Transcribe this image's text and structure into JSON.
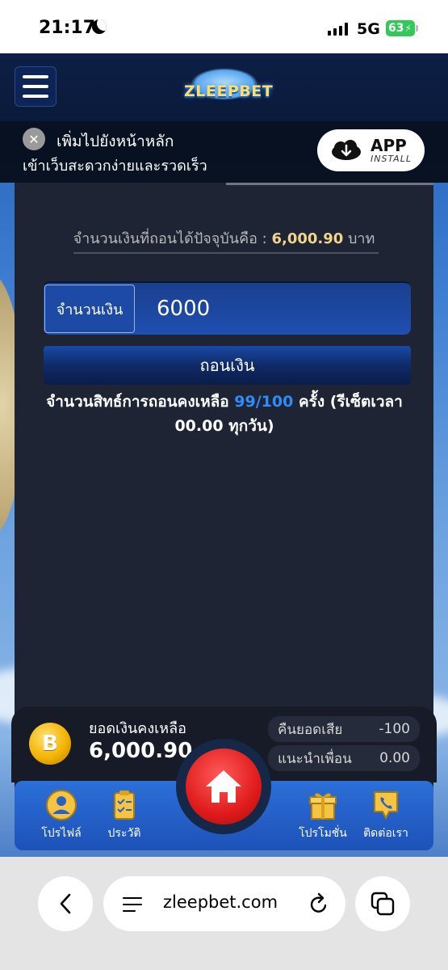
{
  "status": {
    "time": "21:17",
    "network": "5G",
    "battery": "63"
  },
  "header": {
    "logo_text": "ZLEEPBET"
  },
  "banner": {
    "title": "เพิ่มไปยังหน้าหลัก",
    "subtitle": "เข้าเว็บสะดวกง่ายและรวดเร็ว",
    "app_label": "APP",
    "install_label": "INSTALL"
  },
  "withdraw": {
    "available_label": "จำนวนเงินที่ถอนได้ปัจจุบันคือ : ",
    "available_value": "6,000.90",
    "currency": " บาท",
    "amount_label": "จำนวนเงิน",
    "amount_value": "6000",
    "button_label": "ถอนเงิน",
    "rights_prefix": "จำนวนสิทธ์การถอนคงเหลือ ",
    "rights_value": "99/100",
    "rights_suffix": " ครั้ง (รีเซ็ตเวลา 00.00 ทุกวัน)"
  },
  "dashboard": {
    "coin_symbol": "B",
    "balance_label": "ยอดเงินคงเหลือ",
    "balance_value": "6,000.90",
    "cashback_label": "คืนยอดเสีย",
    "cashback_value": "-100",
    "referral_label": "แนะนำเพื่อน",
    "referral_value": "0.00"
  },
  "nav": {
    "profile": "โปรไฟล์",
    "history": "ประวัติ",
    "promotion": "โปรโมชั่น",
    "contact": "ติดต่อเรา"
  },
  "browser": {
    "url": "zleepbet.com"
  },
  "colors": {
    "accent_blue": "#2d8cff",
    "gold": "#f2d58b",
    "home_red": "#e01b1b",
    "battery_green": "#34c759"
  }
}
